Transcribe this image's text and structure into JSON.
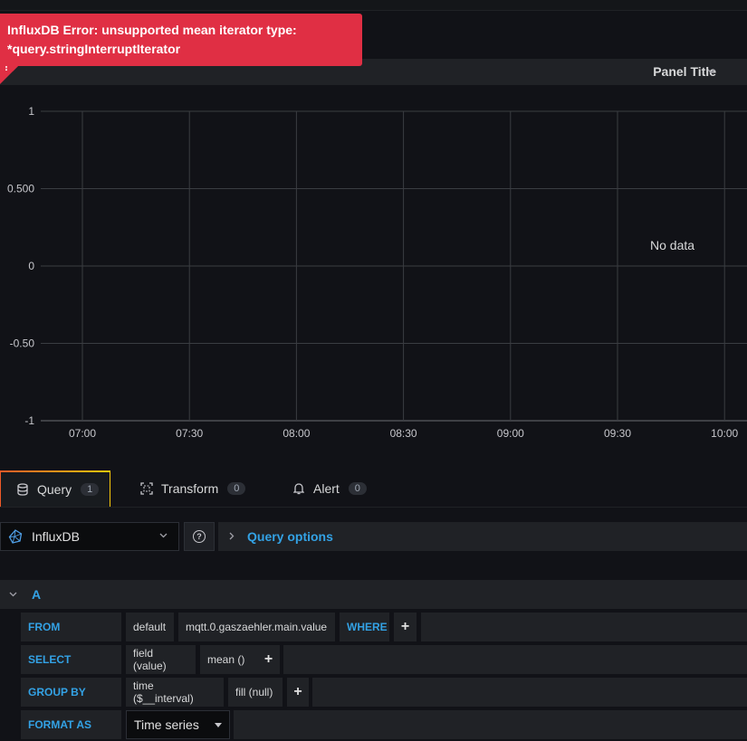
{
  "error": {
    "message": "InfluxDB Error: unsupported mean iterator type: *query.stringInterruptIterator",
    "mark": "!"
  },
  "panel": {
    "title": "Panel Title",
    "no_data": "No data"
  },
  "chart_data": {
    "type": "line",
    "title": "",
    "xlabel": "",
    "ylabel": "",
    "x_ticks": [
      "07:00",
      "07:30",
      "08:00",
      "08:30",
      "09:00",
      "09:30",
      "10:00"
    ],
    "y_ticks": [
      "1",
      "0.500",
      "0",
      "-0.50",
      "-1"
    ],
    "ylim": [
      -1,
      1
    ],
    "grid": true,
    "series": []
  },
  "tabs": [
    {
      "label": "Query",
      "count": "1",
      "icon": "database-icon"
    },
    {
      "label": "Transform",
      "count": "0",
      "icon": "transform-icon"
    },
    {
      "label": "Alert",
      "count": "0",
      "icon": "bell-icon"
    }
  ],
  "datasource": {
    "name": "InfluxDB",
    "help": "?",
    "query_options": "Query options"
  },
  "query": {
    "ref_id": "A",
    "from": {
      "keyword": "FROM",
      "policy": "default",
      "measurement": "mqtt.0.gaszaehler.main.value",
      "where": "WHERE",
      "plus": "+"
    },
    "select": {
      "keyword": "SELECT",
      "field": "field (value)",
      "agg": "mean ()",
      "plus": "+"
    },
    "group_by": {
      "keyword": "GROUP BY",
      "time": "time ($__interval)",
      "fill": "fill (null)",
      "plus": "+"
    },
    "format_as": {
      "keyword": "FORMAT AS",
      "value": "Time series"
    }
  },
  "colors": {
    "error": "#e02f44",
    "accent": "#33a2e5",
    "background": "#111217",
    "grid": "#3a3d42"
  }
}
